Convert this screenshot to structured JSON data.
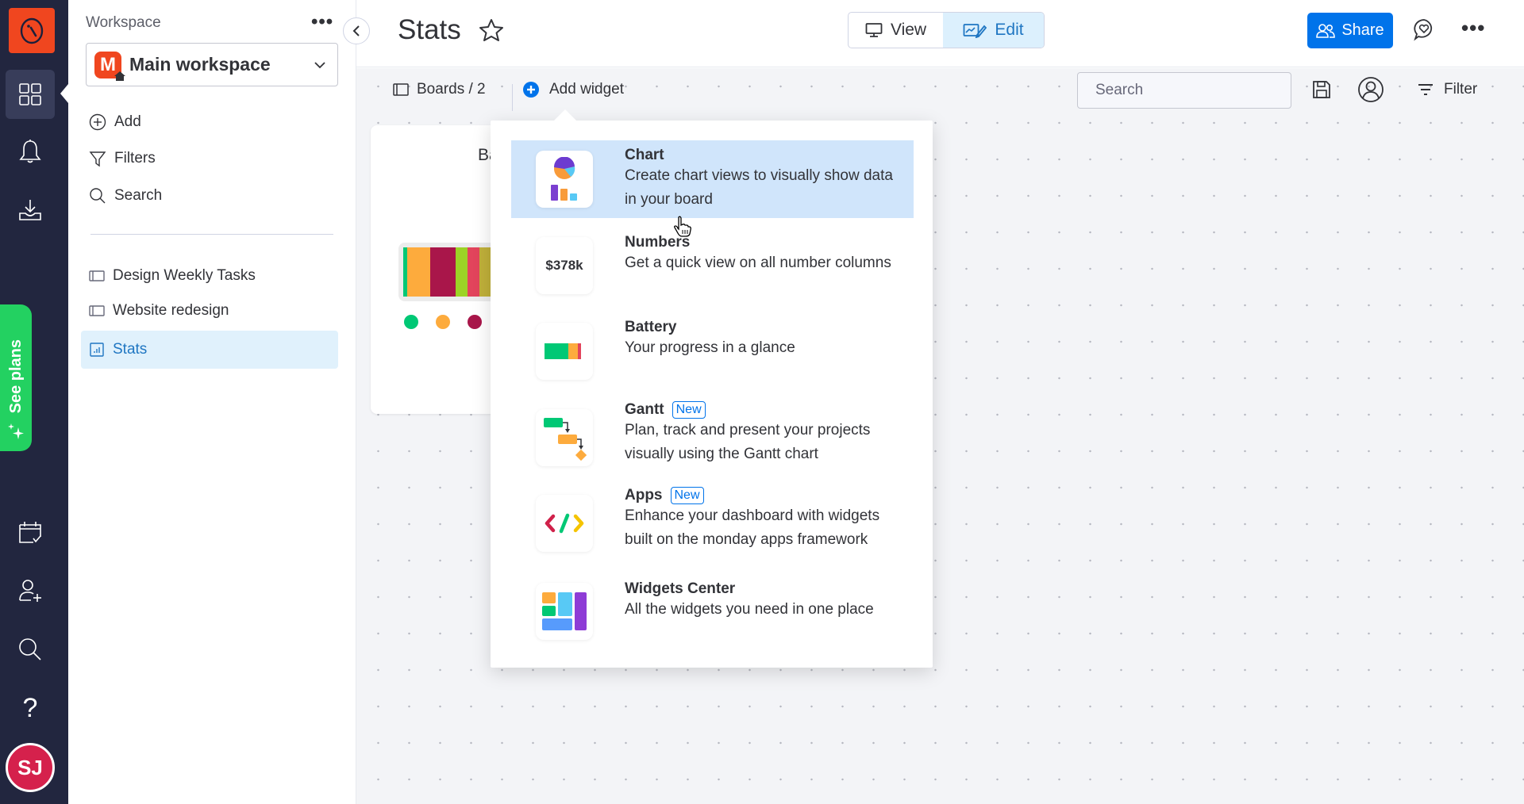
{
  "rail": {
    "logo_icon": "monday-logo",
    "items": [
      {
        "icon": "workspace-grid-icon",
        "active": true
      },
      {
        "icon": "bell-icon"
      },
      {
        "icon": "inbox-download-icon"
      },
      {
        "icon": "calendar-check-icon"
      },
      {
        "icon": "invite-user-icon"
      },
      {
        "icon": "search-icon"
      },
      {
        "icon": "help-icon",
        "glyph": "?"
      }
    ],
    "see_plans_label": "See plans",
    "avatar_initials": "SJ",
    "avatar_color": "#d5214c"
  },
  "workspace": {
    "label": "Workspace",
    "more_label": "•••",
    "badge_letter": "M",
    "name": "Main workspace",
    "actions": [
      {
        "label": "Add",
        "icon": "plus-circle-icon"
      },
      {
        "label": "Filters",
        "icon": "filter-icon"
      },
      {
        "label": "Search",
        "icon": "search-icon"
      }
    ],
    "items": [
      {
        "label": "Design Weekly Tasks",
        "icon": "board-icon",
        "active": false
      },
      {
        "label": "Website redesign",
        "icon": "board-icon",
        "active": false
      },
      {
        "label": "Stats",
        "icon": "dashboard-icon",
        "active": true
      }
    ]
  },
  "header": {
    "title": "Stats",
    "view_label": "View",
    "edit_label": "Edit",
    "active_mode": "Edit",
    "share_label": "Share",
    "more_label": "•••"
  },
  "toolbar": {
    "boards_label": "Boards / 2",
    "add_widget_label": "Add widget",
    "search_placeholder": "Search",
    "filter_label": "Filter"
  },
  "widget": {
    "title_visible": "Ba",
    "battery_segments": [
      {
        "color": "#00c875",
        "share": 0.8
      },
      {
        "color": "#fdab3d",
        "share": 5.0
      },
      {
        "color": "#a9164a",
        "share": 5.5
      },
      {
        "color": "#9cd326",
        "share": 2.6
      },
      {
        "color": "#e2445c",
        "share": 2.6
      },
      {
        "color": "#c0b03a",
        "share": 2.8
      },
      {
        "color": "#c4c4c4",
        "share": 18.0
      }
    ],
    "legend_colors": [
      "#00c875",
      "#fdab3d",
      "#a9164a"
    ]
  },
  "dropdown": {
    "items": [
      {
        "title": "Chart",
        "desc": "Create chart views to visually show data in your board",
        "icon": "chart-icon",
        "new": false,
        "hover": true
      },
      {
        "title": "Numbers",
        "desc": "Get a quick view on all number columns",
        "icon": "numbers-icon",
        "icon_text": "$378k",
        "new": false
      },
      {
        "title": "Battery",
        "desc": "Your progress in a glance",
        "icon": "battery-icon",
        "new": false
      },
      {
        "title": "Gantt",
        "desc": "Plan, track and present your projects visually using the Gantt chart",
        "icon": "gantt-icon",
        "new": true
      },
      {
        "title": "Apps",
        "desc": "Enhance your dashboard with widgets built on the monday apps framework",
        "icon": "apps-code-icon",
        "new": true
      },
      {
        "title": "Widgets Center",
        "desc": "All the widgets you need in one place",
        "icon": "widgets-center-icon",
        "new": false
      }
    ],
    "new_badge_label": "New"
  }
}
